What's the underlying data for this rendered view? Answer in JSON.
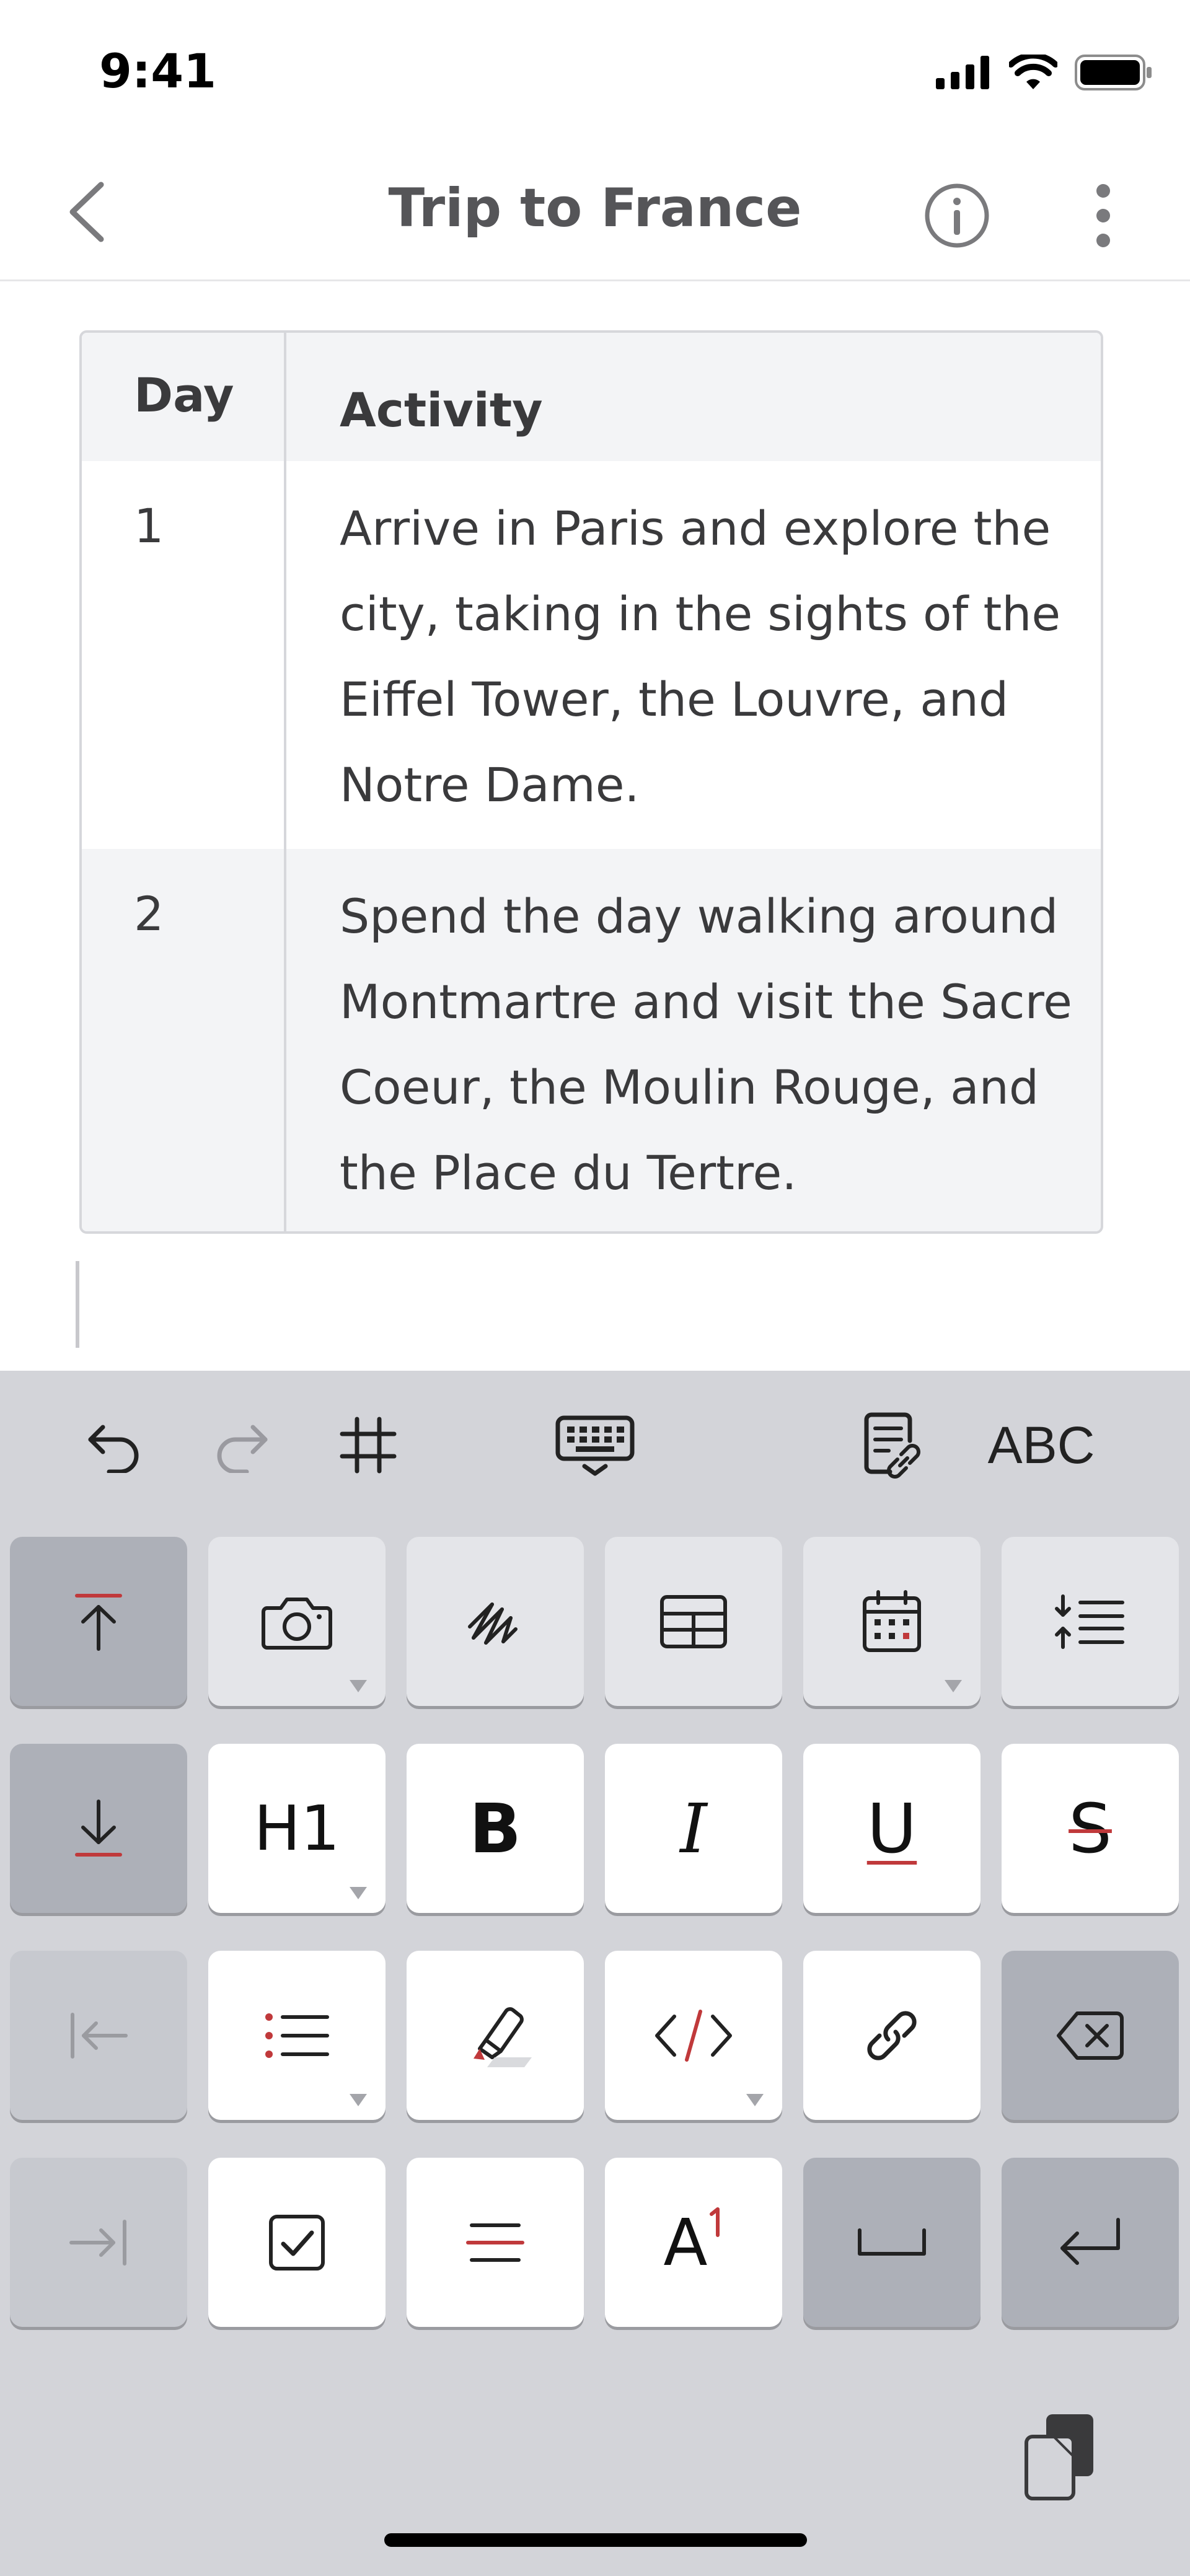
{
  "status_bar": {
    "time": "9:41"
  },
  "nav": {
    "title": "Trip to France"
  },
  "table": {
    "headers": [
      "Day",
      "Activity"
    ],
    "rows": [
      {
        "day": "1",
        "activity": "Arrive in Paris and explore the city, taking in the sights of the Eiffel Tower, the Louvre, and Notre Dame."
      },
      {
        "day": "2",
        "activity": "Spend the day walking around Montmartre and visit the Sacre Coeur, the Moulin Rouge, and the Place du Tertre."
      }
    ]
  },
  "keyboard": {
    "toolbar": {
      "abc_label": "ABC"
    },
    "keys": {
      "heading_label": "H1",
      "bold_label": "B",
      "italic_label": "I",
      "underline_label": "U",
      "strike_label": "S",
      "superscript_label": "A"
    }
  },
  "colors": {
    "accent": "#c0393b",
    "keyboard_bg": "#d3d4d9"
  }
}
